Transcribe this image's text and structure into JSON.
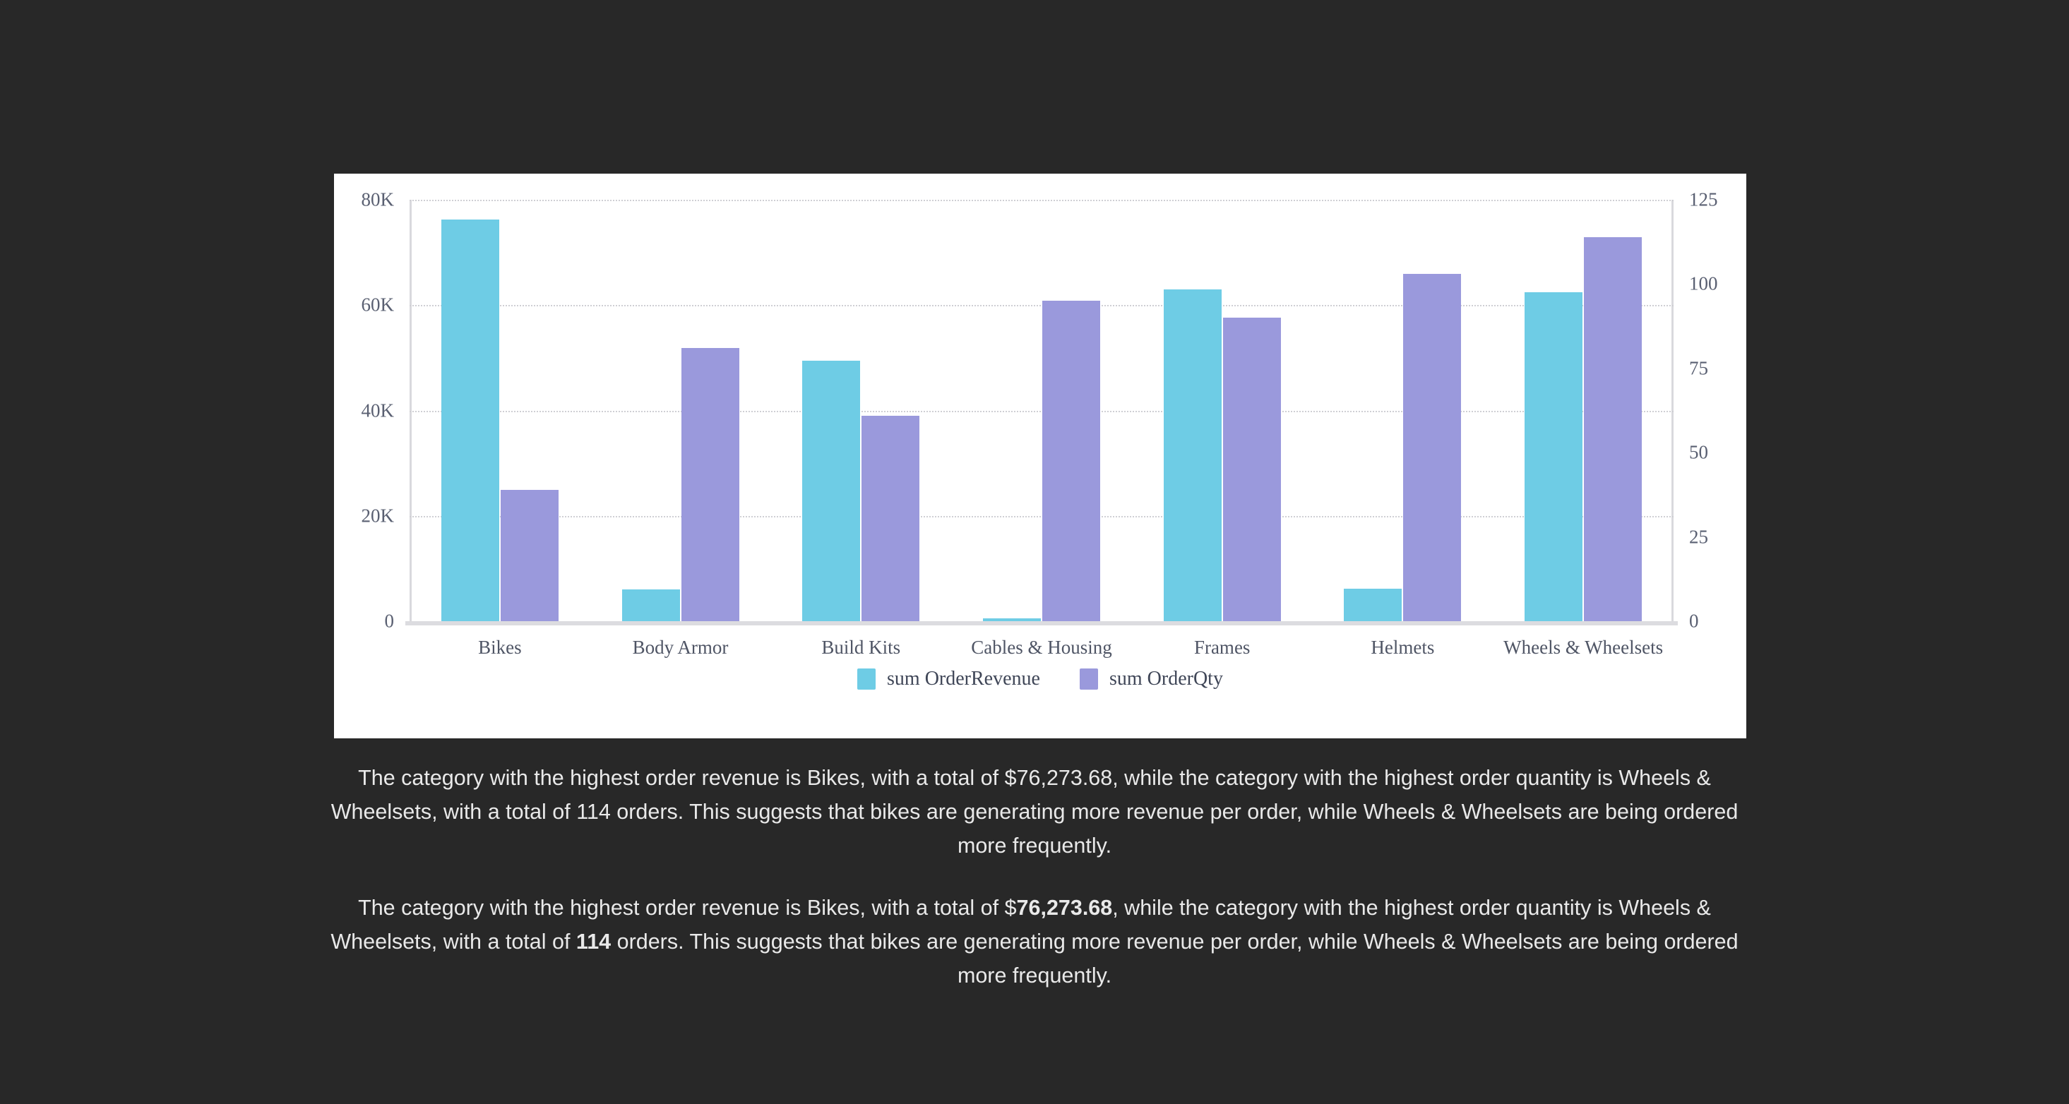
{
  "theme": {
    "background": "#282828",
    "card_background": "#ffffff",
    "series_revenue_color": "#6ecce5",
    "series_qty_color": "#9a99dc",
    "text_color": "#e9e9e9",
    "axis_text_color": "#5a6072"
  },
  "chart_data": {
    "type": "bar",
    "title": "",
    "subtitle": "",
    "xlabel": "",
    "ylabel": "",
    "grid": true,
    "legend_position": "bottom",
    "categories": [
      "Bikes",
      "Body Armor",
      "Build Kits",
      "Cables & Housing",
      "Frames",
      "Helmets",
      "Wheels & Wheelsets"
    ],
    "axes": {
      "left": {
        "name": "sum OrderRevenue",
        "ticks": [
          "0",
          "20K",
          "40K",
          "60K",
          "80K"
        ],
        "tick_values": [
          0,
          20000,
          40000,
          60000,
          80000
        ],
        "ylim": [
          0,
          80000
        ]
      },
      "right": {
        "name": "sum OrderQty",
        "ticks": [
          "0",
          "25",
          "50",
          "75",
          "100",
          "125"
        ],
        "tick_values": [
          0,
          25,
          50,
          75,
          100,
          125
        ],
        "ylim": [
          0,
          125
        ]
      }
    },
    "series": [
      {
        "name": "sum OrderRevenue",
        "axis": "left",
        "color": "#6ecce5",
        "values": [
          76273.68,
          6000,
          49500,
          600,
          63000,
          6200,
          62500
        ]
      },
      {
        "name": "sum OrderQty",
        "axis": "right",
        "color": "#9a99dc",
        "values": [
          39,
          81,
          61,
          95,
          90,
          103,
          114
        ]
      }
    ]
  },
  "legend": {
    "items": [
      {
        "label": "sum OrderRevenue",
        "color": "#6ecce5",
        "swatch_name": "legend-swatch-revenue"
      },
      {
        "label": "sum OrderQty",
        "color": "#9a99dc",
        "swatch_name": "legend-swatch-qty"
      }
    ]
  },
  "summary_plain": "The category with the highest order revenue is Bikes, with a total of $76,273.68, while the category with the highest order quantity is Wheels & Wheelsets, with a total of 114 orders. This suggests that bikes are generating more revenue per order, while Wheels & Wheelsets are being ordered more frequently.",
  "summary_rich": {
    "part1": "The category with the highest order revenue is Bikes, with a total of $",
    "bold1": "76,273.68",
    "part2": ", while the category with the highest order quantity is Wheels & Wheelsets, with a total of ",
    "bold2": "114",
    "part3": " orders. This suggests that bikes are generating more revenue per order, while Wheels & Wheelsets are being ordered more frequently."
  }
}
